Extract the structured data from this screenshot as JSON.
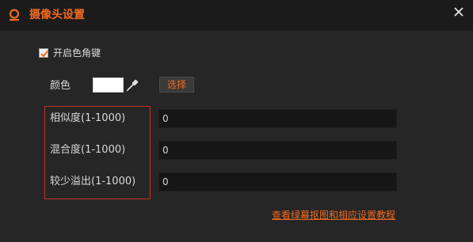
{
  "window": {
    "title": "摄像头设置",
    "logo_icon": "webcam-logo-icon",
    "close_icon": "close-icon",
    "accent_color": "#f06b20"
  },
  "chroma_key": {
    "enabled": true,
    "enable_label": "开启色角键",
    "color_label": "颜色",
    "color_value": "#ffffff",
    "picker_icon": "eyedropper-icon",
    "select_button": "选择"
  },
  "settings": [
    {
      "label": "相似度(1-1000)",
      "value": "0"
    },
    {
      "label": "混合度(1-1000)",
      "value": "0"
    },
    {
      "label": "较少溢出(1-1000)",
      "value": "0"
    }
  ],
  "tutorial_link": "查看绿幕抠图和相应设置教程"
}
